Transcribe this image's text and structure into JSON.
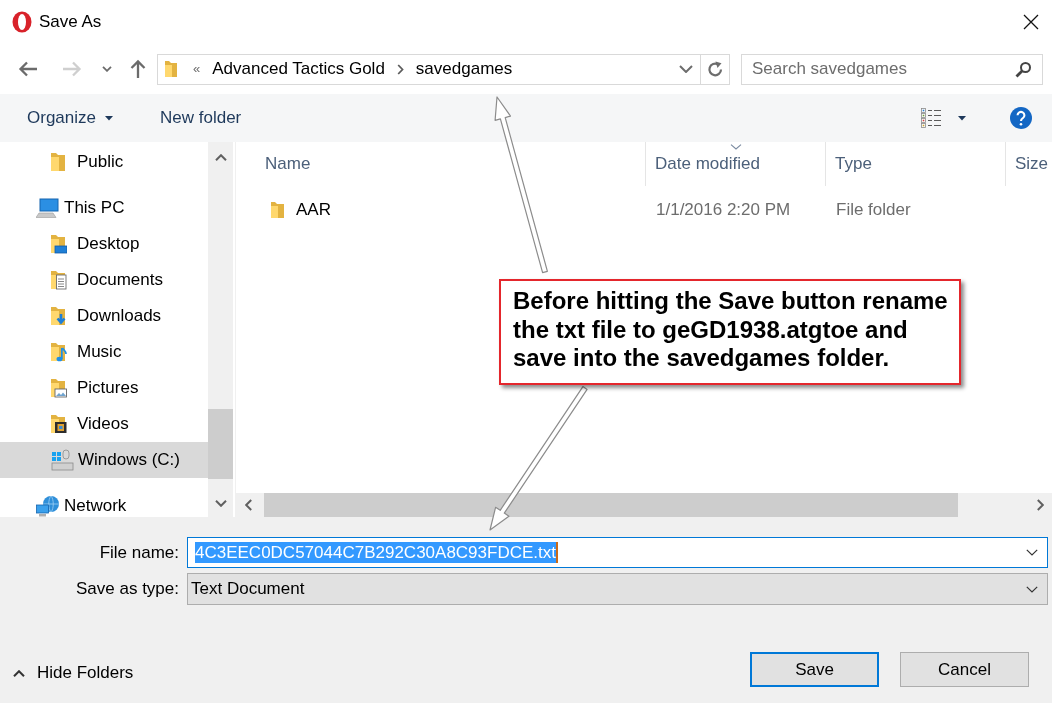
{
  "window": {
    "title": "Save As"
  },
  "navigation": [
    {
      "kind": "back",
      "disabled": false
    },
    {
      "kind": "forward",
      "disabled": true
    },
    {
      "kind": "recent",
      "disabled": false
    },
    {
      "kind": "up",
      "disabled": false
    }
  ],
  "address_bar": {
    "overflow": "«",
    "path": [
      "Advanced Tactics Gold",
      "savedgames"
    ]
  },
  "search": {
    "placeholder": "Search savedgames"
  },
  "command_bar": {
    "items": [
      {
        "label": "Organize",
        "kind": "menu"
      },
      {
        "label": "New folder",
        "kind": "button"
      }
    ]
  },
  "nav_pane": {
    "items": [
      {
        "children": [
          {
            "label": "Public",
            "kind": "folder",
            "selected": false
          }
        ]
      },
      {
        "label": "This PC",
        "kind": "computer",
        "selected": false,
        "children": [
          {
            "label": "Desktop",
            "kind": "desktop",
            "selected": false
          },
          {
            "label": "Documents",
            "kind": "documents",
            "selected": false
          },
          {
            "label": "Downloads",
            "kind": "downloads",
            "selected": false
          },
          {
            "label": "Music",
            "kind": "music",
            "selected": false
          },
          {
            "label": "Pictures",
            "kind": "pictures",
            "selected": false
          },
          {
            "label": "Videos",
            "kind": "videos",
            "selected": false
          },
          {
            "label": "Windows (C:)",
            "kind": "drive",
            "selected": true
          }
        ]
      },
      {
        "label": "Network",
        "kind": "network",
        "selected": false
      }
    ]
  },
  "file_list": {
    "columns": [
      {
        "label": "Name",
        "sorted": false
      },
      {
        "label": "Date modified",
        "sorted": true
      },
      {
        "label": "Type",
        "sorted": false
      },
      {
        "label": "Size",
        "sorted": false
      }
    ],
    "rows": [
      {
        "name": "AAR",
        "date_modified": "1/1/2016 2:20 PM",
        "type": "File folder",
        "selected": false
      }
    ]
  },
  "file_name": {
    "label": "File name:",
    "value": "4C3EEC0DC57044C7B292C30A8C93FDCE.txt",
    "value_selected": true
  },
  "save_as_type": {
    "label": "Save as type:",
    "value": "Text Document"
  },
  "hide_folders": {
    "label": "Hide Folders"
  },
  "buttons": [
    {
      "label": "Save",
      "default": true
    },
    {
      "label": "Cancel",
      "default": false
    }
  ],
  "annotation": {
    "text": "Before hitting the Save button rename the txt file to geGD1938.atgtoe and save into the savedgames folder."
  }
}
